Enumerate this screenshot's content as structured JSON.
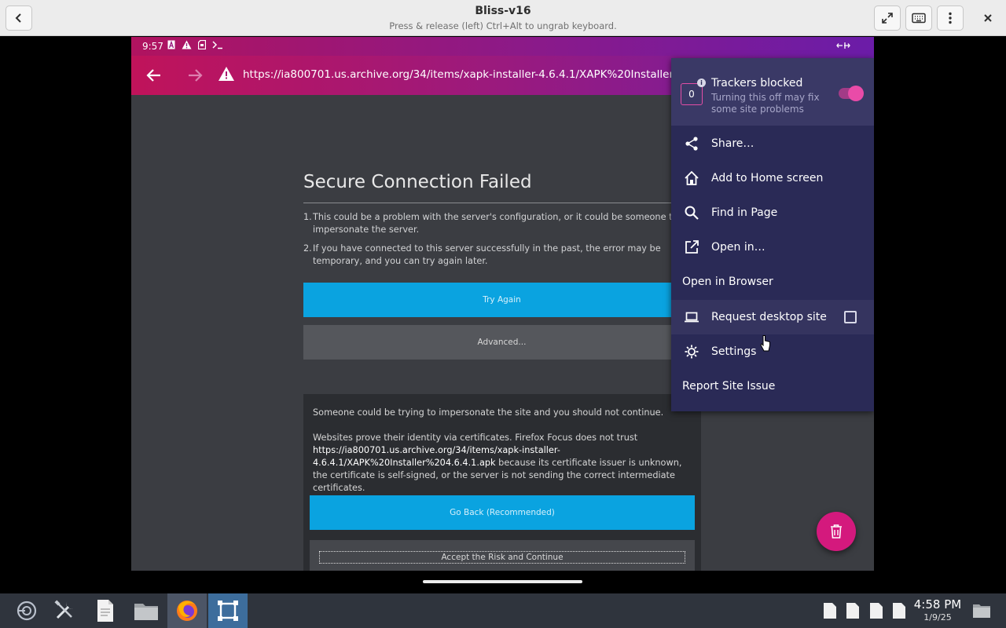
{
  "window": {
    "title": "Bliss-v16",
    "subtitle": "Press & release (left) Ctrl+Alt to ungrab keyboard."
  },
  "statusbar": {
    "time": "9:57",
    "icons": [
      "a-badge-icon",
      "warning-icon",
      "sd-card-icon",
      "terminal-icon"
    ]
  },
  "urlbar": {
    "url": "https://ia800701.us.archive.org/34/items/xapk-installer-4.6.4.1/XAPK%20Installer%204.6."
  },
  "error_page": {
    "title": "Secure Connection Failed",
    "items": [
      {
        "num": "1.",
        "text": "This could be a problem with the server's configuration, or it could be someone trying to impersonate the server."
      },
      {
        "num": "2.",
        "text": "If you have connected to this server successfully in the past, the error may be temporary, and you can try again later."
      }
    ],
    "try_again": "Try Again",
    "advanced": "Advanced...",
    "adv_warning": "Someone could be trying to impersonate the site and you should not continue.",
    "adv_text_a": "Websites prove their identity via certificates. Firefox Focus does not trust ",
    "adv_url": "https://ia800701.us.archive.org/34/items/xapk-installer-4.6.4.1/XAPK%20Installer%204.6.4.1.apk",
    "adv_text_b": " because its certificate issuer is unknown, the certificate is self-signed, or the server is not sending the correct intermediate certificates.",
    "go_back": "Go Back (Recommended)",
    "accept": "Accept the Risk and Continue"
  },
  "menu": {
    "tracker_count": "0",
    "trackers_title": "Trackers blocked",
    "trackers_sub": "Turning this off may fix some site problems",
    "trackers_enabled": true,
    "items": [
      {
        "label": "Share…",
        "icon": "share-icon"
      },
      {
        "label": "Add to Home screen",
        "icon": "home-icon"
      },
      {
        "label": "Find in Page",
        "icon": "search-icon"
      },
      {
        "label": "Open in…",
        "icon": "open-external-icon"
      },
      {
        "label": "Open in Browser",
        "icon": ""
      },
      {
        "label": "Request desktop site",
        "icon": "laptop-icon",
        "checked": false
      },
      {
        "label": "Settings",
        "icon": "gear-icon"
      },
      {
        "label": "Report Site Issue",
        "icon": ""
      }
    ]
  },
  "taskbar": {
    "time": "4:58 PM",
    "date": "1/9/25"
  },
  "colors": {
    "accent_pink": "#e94ba8",
    "button_blue": "#0aa3e0",
    "menu_bg": "#2a2a56"
  }
}
